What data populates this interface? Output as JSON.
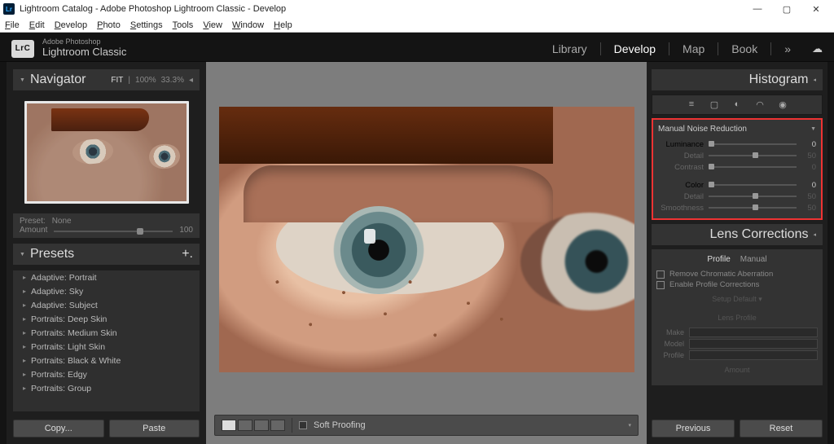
{
  "titlebar": {
    "text": "Lightroom Catalog - Adobe Photoshop Lightroom Classic - Develop",
    "icon_label": "Lr"
  },
  "menubar": [
    "File",
    "Edit",
    "Develop",
    "Photo",
    "Settings",
    "Tools",
    "View",
    "Window",
    "Help"
  ],
  "brand": {
    "small": "Adobe Photoshop",
    "large": "Lightroom Classic",
    "badge": "LrC"
  },
  "modules": {
    "items": [
      "Library",
      "Develop",
      "Map",
      "Book"
    ],
    "active": "Develop",
    "more": "»"
  },
  "navigator": {
    "title": "Navigator",
    "zoom_mode": "FIT",
    "zoom_levels": [
      "100%",
      "33.3%"
    ],
    "chevron": "◂"
  },
  "preset_box": {
    "label": "Preset:",
    "value": "None",
    "amount_label": "Amount",
    "amount_value": "100"
  },
  "presets_panel": {
    "title": "Presets",
    "add": "+.",
    "items": [
      "Adaptive: Portrait",
      "Adaptive: Sky",
      "Adaptive: Subject",
      "Portraits: Deep Skin",
      "Portraits: Medium Skin",
      "Portraits: Light Skin",
      "Portraits: Black & White",
      "Portraits: Edgy",
      "Portraits: Group"
    ]
  },
  "left_buttons": {
    "copy": "Copy...",
    "paste": "Paste"
  },
  "center_toolbar": {
    "soft_proofing": "Soft Proofing"
  },
  "histogram": {
    "title": "Histogram"
  },
  "noise_reduction": {
    "title": "Manual Noise Reduction",
    "sliders": [
      {
        "label": "Luminance",
        "value": "0",
        "pos": 0,
        "dim": false
      },
      {
        "label": "Detail",
        "value": "50",
        "pos": 50,
        "dim": true
      },
      {
        "label": "Contrast",
        "value": "0",
        "pos": 0,
        "dim": true
      },
      {
        "label": "Color",
        "value": "0",
        "pos": 0,
        "dim": false
      },
      {
        "label": "Detail",
        "value": "50",
        "pos": 50,
        "dim": true
      },
      {
        "label": "Smoothness",
        "value": "50",
        "pos": 50,
        "dim": true
      }
    ]
  },
  "lens": {
    "title": "Lens Corrections",
    "tabs": [
      "Profile",
      "Manual"
    ],
    "active_tab": "Profile",
    "cb1": "Remove Chromatic Aberration",
    "cb2": "Enable Profile Corrections",
    "setup": "Setup   Default ▾",
    "profile_header": "Lens Profile",
    "fields": [
      "Make",
      "Model",
      "Profile"
    ],
    "amount_header": "Amount"
  },
  "right_buttons": {
    "previous": "Previous",
    "reset": "Reset"
  },
  "icons": {
    "sliders": "≡",
    "crop": "▢",
    "heal": "◐",
    "mask": "◠",
    "eye": "◉"
  }
}
